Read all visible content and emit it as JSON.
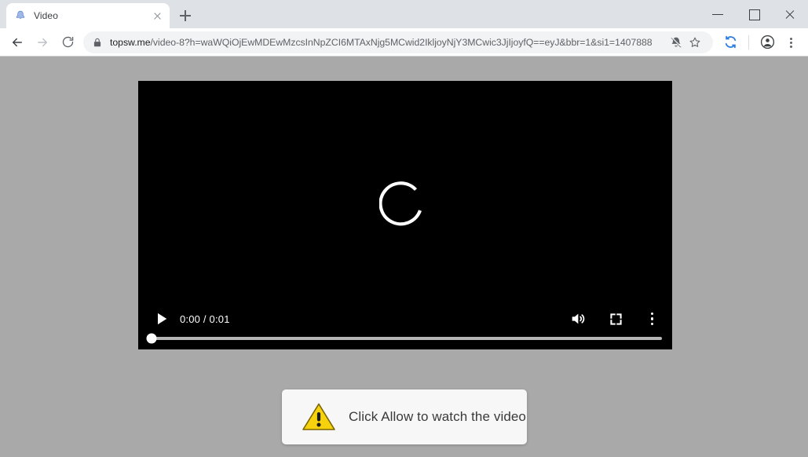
{
  "window": {
    "controls": {
      "minimize_label": "Minimize",
      "maximize_label": "Maximize",
      "close_label": "Close"
    }
  },
  "tabstrip": {
    "tabs": [
      {
        "title": "Video",
        "favicon": "bell-favicon",
        "active": true
      }
    ],
    "new_tab_label": "New tab",
    "close_tab_label": "Close tab"
  },
  "toolbar": {
    "back_label": "Back",
    "forward_label": "Forward",
    "reload_label": "Reload",
    "security_icon": "lock-icon",
    "url_host": "topsw.me",
    "url_path": "/video-8?h=waWQiOjEwMDEwMzcsInNpZCI6MTAxNjg5MCwid2IkljoyNjY3MCwic3JjIjoyfQ==eyJ&bbr=1&si1=1407888",
    "notifications_blocked_label": "Notifications blocked",
    "bookmark_label": "Bookmark this tab",
    "extension_label": "Sync extension",
    "profile_label": "Profile",
    "menu_label": "Customize and control Google Chrome"
  },
  "page": {
    "background_color": "#a9a9a9",
    "video": {
      "state": "loading",
      "spinner_label": "Loading spinner",
      "controls": {
        "play_label": "Play",
        "time_display": "0:00 / 0:01",
        "current_time": "0:00",
        "duration": "0:01",
        "volume_label": "Mute",
        "fullscreen_label": "Full screen",
        "more_options_label": "More options",
        "progress_percent": 0
      }
    },
    "banner": {
      "icon": "warning-triangle-icon",
      "icon_color": "#F5D20D",
      "message": "Click Allow to watch the video"
    }
  }
}
